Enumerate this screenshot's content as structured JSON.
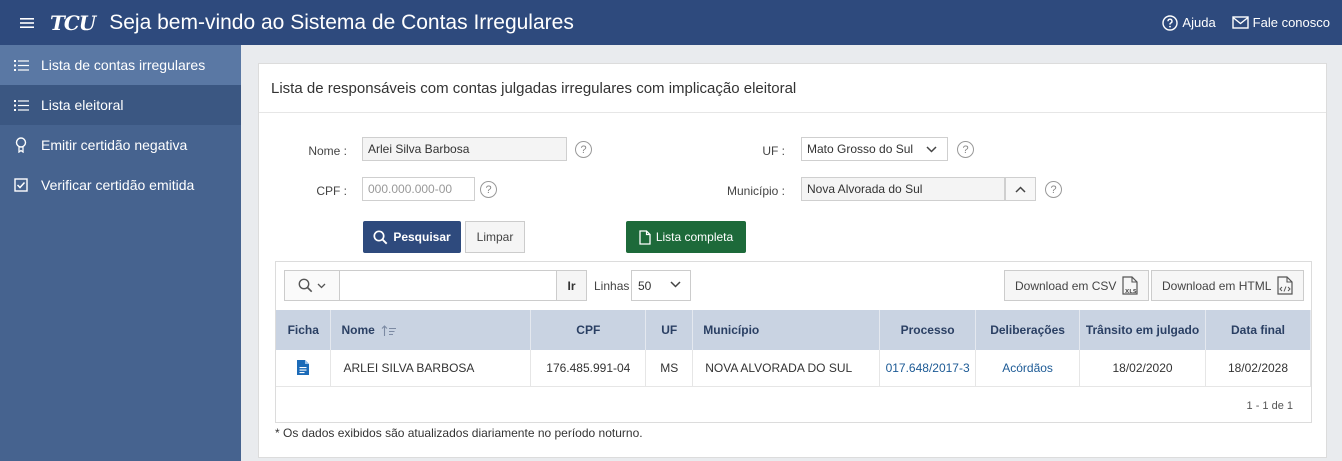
{
  "header": {
    "logo": "TCU",
    "title": "Seja bem-vindo ao Sistema de Contas Irregulares",
    "help_label": "Ajuda",
    "contact_label": "Fale conosco"
  },
  "sidebar": {
    "items": [
      {
        "label": "Lista de contas irregulares",
        "icon": "list-icon"
      },
      {
        "label": "Lista eleitoral",
        "icon": "list-icon"
      },
      {
        "label": "Emitir certidão negativa",
        "icon": "award-icon"
      },
      {
        "label": "Verificar certidão emitida",
        "icon": "checkbox-icon"
      }
    ]
  },
  "main": {
    "title": "Lista de responsáveis com contas julgadas irregulares com implicação eleitoral",
    "form": {
      "nome_label": "Nome :",
      "nome_value": "Arlei Silva Barbosa",
      "cpf_label": "CPF :",
      "cpf_placeholder": "000.000.000-00",
      "uf_label": "UF :",
      "uf_value": "Mato Grosso do Sul",
      "municipio_label": "Município :",
      "municipio_value": "Nova Alvorada do Sul",
      "help": "?"
    },
    "buttons": {
      "search": "Pesquisar",
      "clear": "Limpar",
      "full_list": "Lista completa"
    },
    "report": {
      "go_label": "Ir",
      "rows_label": "Linhas",
      "rows_value": "50",
      "download_csv": "Download em CSV",
      "download_html": "Download em HTML",
      "columns": [
        "Ficha",
        "Nome",
        "CPF",
        "UF",
        "Município",
        "Processo",
        "Deliberações",
        "Trânsito em julgado",
        "Data final"
      ],
      "rows": [
        {
          "nome": "ARLEI SILVA BARBOSA",
          "cpf": "176.485.991-04",
          "uf": "MS",
          "municipio": "NOVA ALVORADA DO SUL",
          "processo": "017.648/2017-3",
          "deliberacoes": "Acórdãos",
          "transito": "18/02/2020",
          "data_final": "18/02/2028"
        }
      ],
      "pagination": "1 - 1 de 1"
    },
    "footnote": "* Os dados exibidos são atualizados diariamente no período noturno."
  },
  "colors": {
    "header_bg": "#2e4a7d",
    "sidebar_bg": "#46638f",
    "sidebar_active": "#5a78a4",
    "primary_button": "#2e4a7d",
    "green_button": "#1d6a3a",
    "table_header": "#c9d3e2",
    "link": "#1c5a95"
  }
}
